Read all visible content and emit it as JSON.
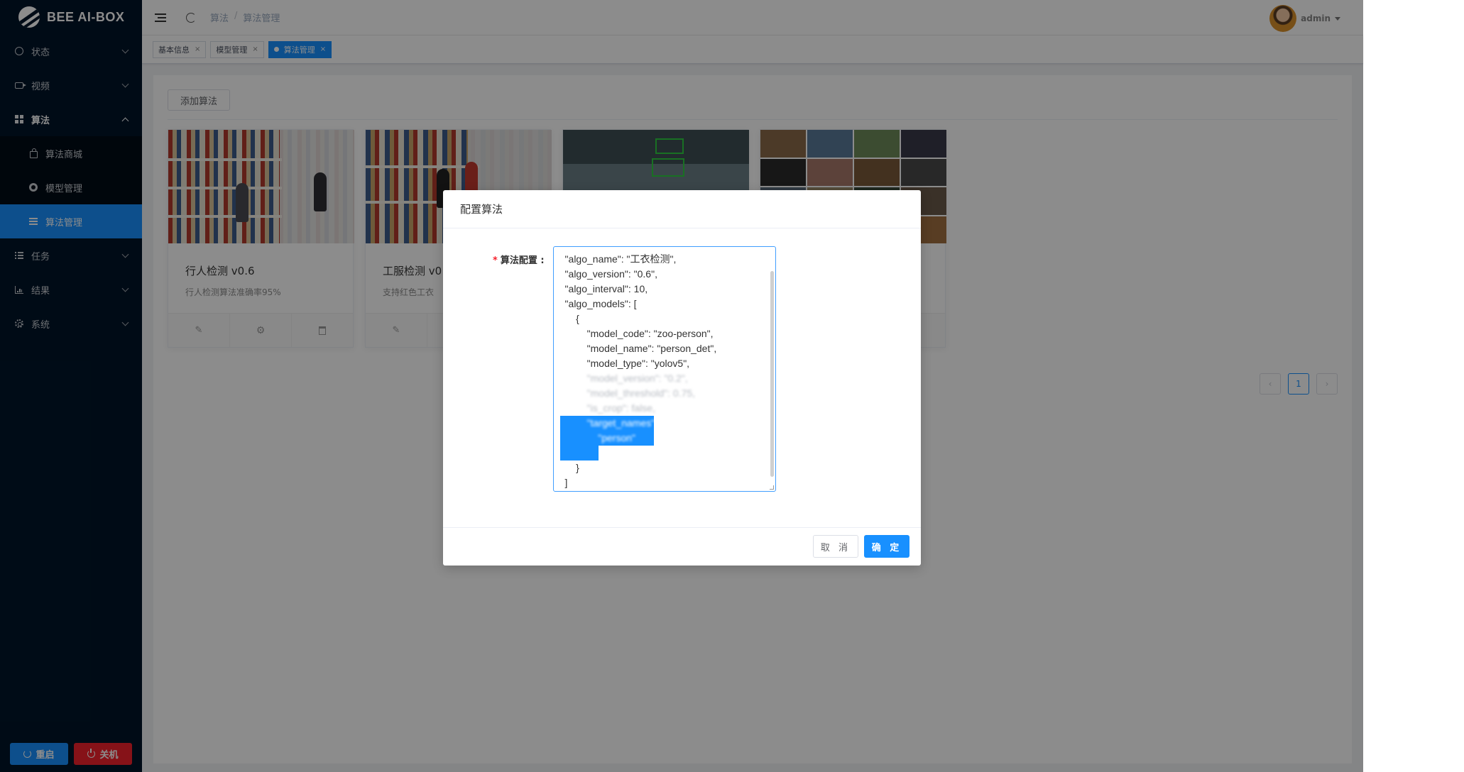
{
  "app": {
    "logo_text": "BEE AI-BOX"
  },
  "sidebar": {
    "items": [
      {
        "label": "状态",
        "icon": "dashboard-icon"
      },
      {
        "label": "视频",
        "icon": "video-icon"
      },
      {
        "label": "算法",
        "icon": "grid-icon",
        "open": true
      },
      {
        "label": "任务",
        "icon": "task-icon"
      },
      {
        "label": "结果",
        "icon": "chart-icon"
      },
      {
        "label": "系统",
        "icon": "gear-icon"
      }
    ],
    "sub_items": [
      {
        "label": "算法商城",
        "icon": "shop-bag-icon"
      },
      {
        "label": "模型管理",
        "icon": "model-icon"
      },
      {
        "label": "算法管理",
        "icon": "list-icon",
        "active": true
      }
    ],
    "restart_label": "重启",
    "shutdown_label": "关机"
  },
  "header": {
    "breadcrumb": [
      "算法",
      "算法管理"
    ],
    "username": "admin"
  },
  "tags": [
    {
      "label": "基本信息"
    },
    {
      "label": "模型管理"
    },
    {
      "label": "算法管理",
      "active": true
    }
  ],
  "content": {
    "add_button": "添加算法",
    "cards": [
      {
        "title": "行人检测 v0.6",
        "desc": "行人检测算法准确率95%"
      },
      {
        "title": "工服检测 v0",
        "desc": "支持红色工衣"
      },
      {
        "title": "",
        "desc": ""
      },
      {
        "title": "",
        "desc": ""
      }
    ],
    "pagination": {
      "current": "1"
    }
  },
  "modal": {
    "title": "配置算法",
    "field_label": "算法配置",
    "code_lines": [
      "    \"algo_name\": \"工衣检测\",",
      "    \"algo_version\": \"0.6\",",
      "    \"algo_interval\": 10,",
      "    \"algo_models\": [",
      "        {",
      "            \"model_code\": \"zoo-person\",",
      "            \"model_name\": \"person_det\",",
      "            \"model_type\": \"yolov5\",",
      "            \"model_version\": \"0.2\",",
      "            \"model_threshold\": 0.75,",
      "            \"is_crop\": false,",
      "            \"target_names\": [",
      "                \"person\"",
      "            ]",
      "        }",
      "    ]"
    ],
    "cancel_label": "取 消",
    "ok_label": "确 定"
  },
  "colors": {
    "sidebar_bg": "#001529",
    "accent": "#1890ff",
    "danger": "#f5222d"
  }
}
